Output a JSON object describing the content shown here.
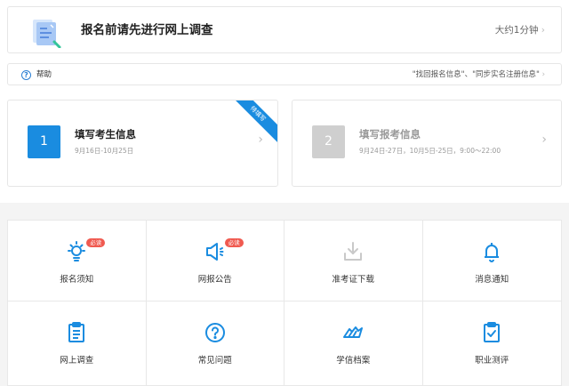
{
  "survey_banner": {
    "title": "报名前请先进行网上调查",
    "duration": "大约1分钟",
    "chevron": "›"
  },
  "help_bar": {
    "label": "帮助",
    "links": "\"找回报名信息\"、\"同步实名注册信息\"",
    "chevron": "›"
  },
  "steps": [
    {
      "number": "1",
      "title": "填写考生信息",
      "dates": "9月16日-10月25日",
      "ribbon": "待填写",
      "chevron": "›",
      "state": "active"
    },
    {
      "number": "2",
      "title": "填写报考信息",
      "dates": "9月24日-27日，10月5日-25日，9:00～22:00",
      "chevron": "›",
      "state": "disabled"
    }
  ],
  "menu": [
    {
      "label": "报名须知",
      "icon": "lightbulb-icon",
      "badge": "必读"
    },
    {
      "label": "网报公告",
      "icon": "megaphone-icon",
      "badge": "必读"
    },
    {
      "label": "准考证下载",
      "icon": "download-icon"
    },
    {
      "label": "消息通知",
      "icon": "bell-icon"
    },
    {
      "label": "网上调查",
      "icon": "clipboard-list-icon"
    },
    {
      "label": "常见问题",
      "icon": "question-icon"
    },
    {
      "label": "学信档案",
      "icon": "wing-icon"
    },
    {
      "label": "职业测评",
      "icon": "clipboard-check-icon"
    }
  ],
  "colors": {
    "accent": "#1a8ce0",
    "badge": "#f05a50",
    "disabled": "#cfcfcf",
    "band": "#f4f4f4"
  }
}
